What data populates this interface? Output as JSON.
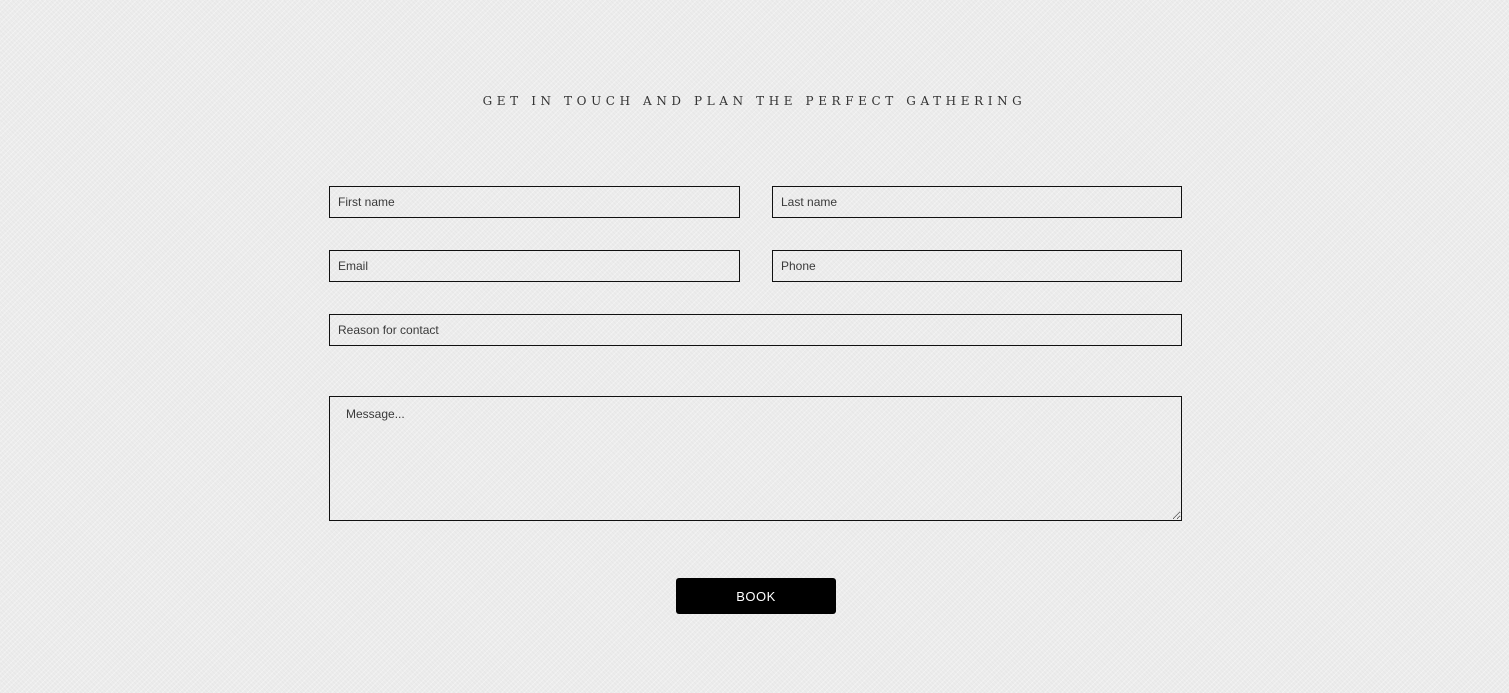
{
  "heading": "GET IN TOUCH AND PLAN THE PERFECT GATHERING",
  "form": {
    "first_name": {
      "value": "",
      "placeholder": "First name"
    },
    "last_name": {
      "value": "",
      "placeholder": "Last name"
    },
    "email": {
      "value": "",
      "placeholder": "Email"
    },
    "phone": {
      "value": "",
      "placeholder": "Phone"
    },
    "reason": {
      "value": "",
      "placeholder": "Reason for contact"
    },
    "message": {
      "value": "",
      "placeholder": "Message..."
    },
    "submit_label": "BOOK"
  },
  "colors": {
    "background": "#ececec",
    "border": "#111111",
    "button_bg": "#000000",
    "button_text": "#ffffff"
  }
}
